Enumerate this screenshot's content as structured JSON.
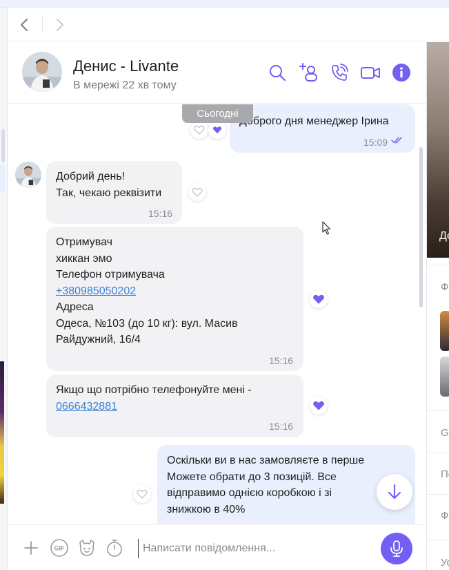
{
  "theme": {
    "accent": "#7360f2",
    "incoming_bubble": "#f2f2f4",
    "outgoing_bubble": "#e9effd",
    "link": "#3a7fd5"
  },
  "nav": {
    "back_icon": "chevron-left-icon",
    "forward_icon": "chevron-right-icon"
  },
  "header": {
    "name": "Денис - Livante",
    "status": "В мережі 22 хв тому",
    "actions": [
      "search-icon",
      "add-participant-icon",
      "voice-call-icon",
      "video-call-icon",
      "info-icon"
    ]
  },
  "date_separator": "Сьогодні",
  "messages": [
    {
      "direction": "out",
      "lines": [
        "Доброго дня менеджер Ірина"
      ],
      "time": "15:09",
      "read": true,
      "reaction": "heart-filled"
    },
    {
      "direction": "in",
      "lines": [
        "Добрий день!",
        "Так, чекаю реквізити"
      ],
      "time": "15:16",
      "reaction": "heart-empty"
    },
    {
      "direction": "in",
      "line1": "Отримувач",
      "line2": "хиккан эмо",
      "line3": "Телефон отримувача",
      "phone": "+380985050202",
      "line5": "Адреса",
      "line6": "Одеса, №103 (до 10 кг): вул. Масив",
      "line7": "Райдужний, 16/4",
      "time": "15:16",
      "reaction": "heart-filled"
    },
    {
      "direction": "in",
      "line1": "Якщо що потрібно телефонуйте мені -",
      "phone": "0666432881",
      "time": "15:16",
      "reaction": "heart-filled"
    },
    {
      "direction": "out",
      "line1": "Оскільки ви в нас замовляєте в перше",
      "line2": "Можете обрати до 3 позицій. Все",
      "line3": "відправимо однією коробкою і зі",
      "line4": "знижкою в 40%",
      "reaction": "heart-empty"
    }
  ],
  "composer": {
    "placeholder": "Написати повідомлення...",
    "icons": [
      "plus-icon",
      "gif-icon",
      "sticker-icon",
      "timer-icon",
      "microphone-icon"
    ]
  },
  "right_panel": {
    "photo_text": "Де",
    "labels": [
      "Ф",
      "Gi",
      "По",
      "Ф",
      "Ус"
    ]
  }
}
